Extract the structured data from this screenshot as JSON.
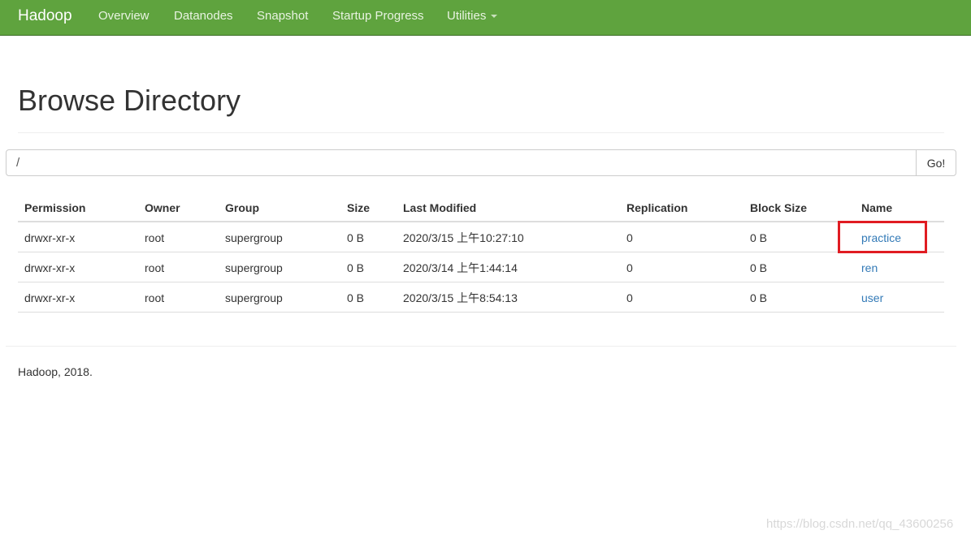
{
  "navbar": {
    "brand": "Hadoop",
    "items": [
      {
        "label": "Overview"
      },
      {
        "label": "Datanodes"
      },
      {
        "label": "Snapshot"
      },
      {
        "label": "Startup Progress"
      },
      {
        "label": "Utilities"
      }
    ]
  },
  "page": {
    "title": "Browse Directory"
  },
  "path_bar": {
    "value": "/",
    "go_label": "Go!"
  },
  "table": {
    "columns": [
      "Permission",
      "Owner",
      "Group",
      "Size",
      "Last Modified",
      "Replication",
      "Block Size",
      "Name"
    ],
    "rows": [
      [
        "drwxr-xr-x",
        "root",
        "supergroup",
        "0 B",
        "2020/3/15 上午10:27:10",
        "0",
        "0 B",
        "practice"
      ],
      [
        "drwxr-xr-x",
        "root",
        "supergroup",
        "0 B",
        "2020/3/14 上午1:44:14",
        "0",
        "0 B",
        "ren"
      ],
      [
        "drwxr-xr-x",
        "root",
        "supergroup",
        "0 B",
        "2020/3/15 上午8:54:13",
        "0",
        "0 B",
        "user"
      ]
    ],
    "highlighted_row": 0
  },
  "footer": {
    "text": "Hadoop, 2018."
  },
  "watermark": "https://blog.csdn.net/qq_43600256",
  "colors": {
    "navbar_bg": "#5fa33e",
    "link": "#337ab7",
    "highlight": "#e01c22"
  }
}
